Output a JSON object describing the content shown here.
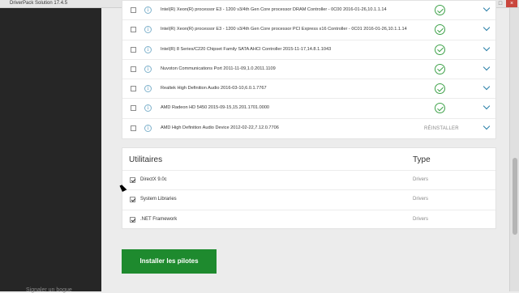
{
  "window": {
    "title": "DriverPack Solution 17.4.5",
    "buttons": [
      "–",
      "□",
      "×"
    ]
  },
  "sidebar": {
    "bottom_link": "Signaler un bogue"
  },
  "drivers": [
    {
      "name": "Intel(R) Xeon(R) processor E3 - 1200 v3/4th Gen Core processor DRAM Controller - 0C00 2016-01-26,10.1.1.14",
      "status": "ok"
    },
    {
      "name": "Intel(R) Xeon(R) processor E3 - 1200 v3/4th Gen Core processor PCI Express x16 Controller - 0C01 2016-01-26,10.1.1.14",
      "status": "ok"
    },
    {
      "name": "Intel(R) 8 Series/C220 Chipset Family SATA AHCI Controller 2015-11-17,14.8.1.1043",
      "status": "ok"
    },
    {
      "name": "Nuvoton Communications Port 2011-11-09,1.0.2011.1109",
      "status": "ok"
    },
    {
      "name": "Realtek High Definition Audio 2016-03-10,6.0.1.7767",
      "status": "ok"
    },
    {
      "name": "AMD Radeon HD 5450 2015-09-15,15.201.1701.0000",
      "status": "ok"
    },
    {
      "name": "AMD High Definition Audio Device 2012-02-22,7.12.0.7706",
      "status": "reinstall",
      "action_label": "RÉINSTALLER"
    }
  ],
  "utilities": {
    "heading": "Utilitaires",
    "type_heading": "Type",
    "items": [
      {
        "name": "DirectX 9.0c",
        "type": "Drivers",
        "checked": true
      },
      {
        "name": "System Libraries",
        "type": "Drivers",
        "checked": true
      },
      {
        "name": ".NET Framework",
        "type": "Drivers",
        "checked": true
      }
    ]
  },
  "install_button": "Installer les pilotes",
  "colors": {
    "accent_green": "#1e8a2e",
    "ok_green": "#3fa24a",
    "chevron_blue": "#2a7fa8",
    "sidebar": "#262626"
  }
}
